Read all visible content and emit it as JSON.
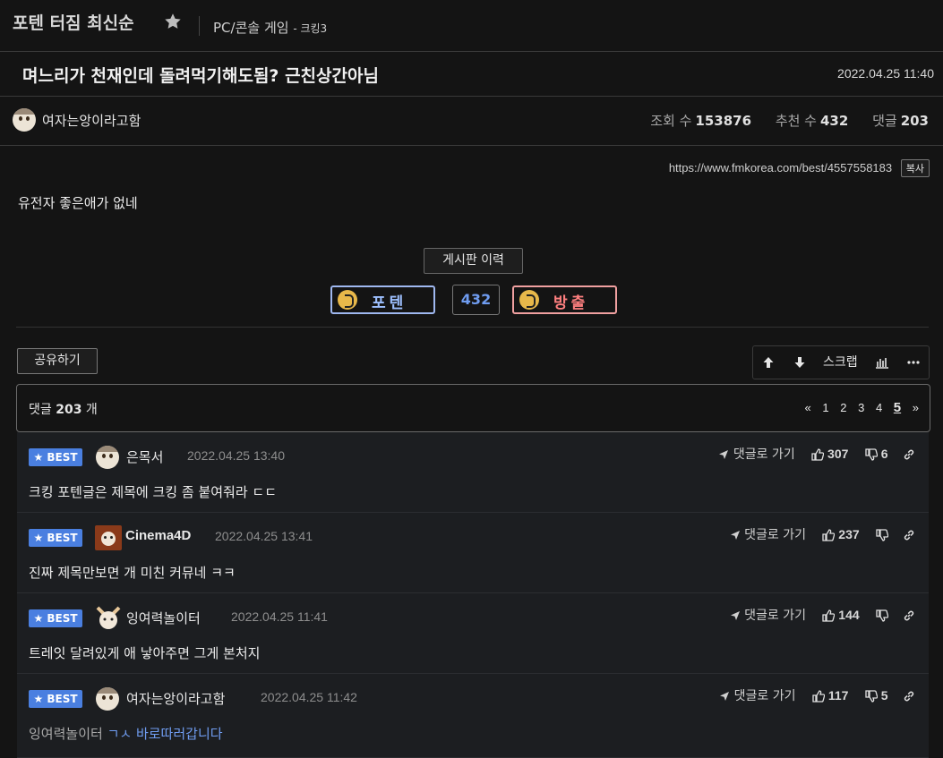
{
  "board": {
    "title": "포텐 터짐 최신순",
    "category": "PC/콘솔 게임",
    "subcategory": "- 크킹3"
  },
  "post": {
    "title": "며느리가 천재인데 돌려먹기해도됨? 근친상간아님",
    "date": "2022.04.25 11:40",
    "author": "여자는앙이라고함",
    "views_label": "조회 수",
    "views": "153876",
    "recommend_label": "추천 수",
    "recommend": "432",
    "comments_label": "댓글",
    "comments": "203",
    "url": "https://www.fmkorea.com/best/4557558183",
    "copy_label": "복사",
    "body": "유전자 좋은애가 없네"
  },
  "actions": {
    "history_label": "게시판 이력",
    "vote_up_label": "포텐",
    "vote_count": "432",
    "vote_down_label": "방출",
    "share_label": "공유하기",
    "scrap_label": "스크랩"
  },
  "comments_header": {
    "prefix": "댓글",
    "count": "203",
    "suffix": "개",
    "pages": [
      "1",
      "2",
      "3",
      "4",
      "5"
    ],
    "current_page": "5"
  },
  "comments": [
    {
      "badge": "BEST",
      "author": "은목서",
      "date": "2022.04.25 13:40",
      "goto": "댓글로 가기",
      "up": "307",
      "down": "6",
      "mention": "",
      "text": "크킹 포텐글은 제목에 크킹 좀 붙여줘라 ㄷㄷ"
    },
    {
      "badge": "BEST",
      "author": "Cinema4D",
      "date": "2022.04.25 13:41",
      "goto": "댓글로 가기",
      "up": "237",
      "down": "",
      "mention": "",
      "text": "진짜 제목만보면 개 미친 커뮤네 ㅋㅋ"
    },
    {
      "badge": "BEST",
      "author": "잉여력놀이터",
      "date": "2022.04.25 11:41",
      "goto": "댓글로 가기",
      "up": "144",
      "down": "",
      "mention": "",
      "text": "트레잇 달려있게 애 낳아주면 그게 본처지"
    },
    {
      "badge": "BEST",
      "author": "여자는앙이라고함",
      "date": "2022.04.25 11:42",
      "goto": "댓글로 가기",
      "up": "117",
      "down": "5",
      "mention": "잉여력놀이터",
      "text": "ㄱㅅ 바로따러갑니다"
    }
  ],
  "colors": {
    "background": "#141414",
    "comment_bg": "#1c1e21",
    "best_badge": "#4a7fe0",
    "vote_up": "#9ec0ff",
    "vote_down": "#ff8080",
    "link": "#6f9cf0"
  }
}
